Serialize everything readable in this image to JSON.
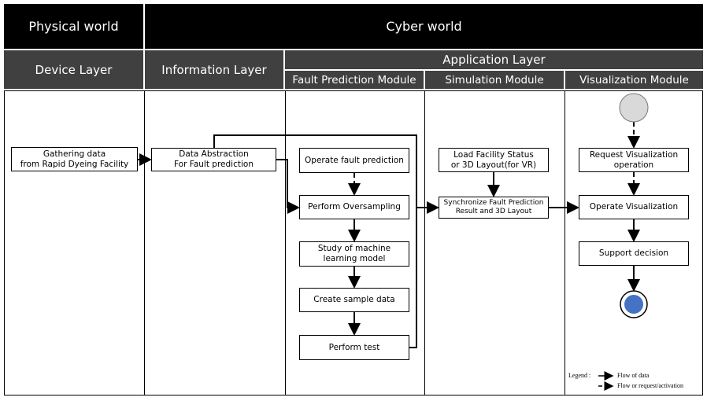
{
  "headers": {
    "physical": "Physical world",
    "cyber": "Cyber world",
    "device": "Device Layer",
    "information": "Information Layer",
    "application": "Application Layer",
    "fault_module": "Fault Prediction Module",
    "simulation_module": "Simulation Module",
    "visualization_module": "Visualization Module"
  },
  "boxes": {
    "gathering": "Gathering data\nfrom Rapid Dyeing Facility",
    "abstraction": "Data Abstraction\nFor Fault prediction",
    "operate_fault": "Operate fault prediction",
    "oversampling": "Perform Oversampling",
    "study": "Study of machine\nlearning model",
    "sample": "Create sample data",
    "test": "Perform test",
    "load": "Load Facility Status\nor 3D Layout(for VR)",
    "synchronize": "Synchronize Fault Prediction\nResult and 3D Layout",
    "request_vis": "Request Visualization\noperation",
    "operate_vis": "Operate Visualization",
    "support": "Support decision"
  },
  "legend": {
    "title": "Legend :",
    "solid": "Flow of data",
    "dashed": "Flow or request/activation"
  },
  "colors": {
    "header_black": "#000000",
    "header_gray": "#404040",
    "start_node": "#d9d9d9",
    "end_node": "#4472c4"
  }
}
